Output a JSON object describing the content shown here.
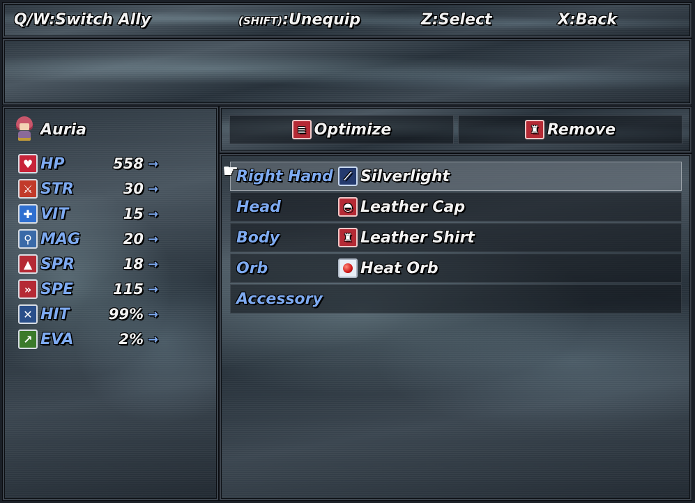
{
  "help_bar": {
    "switch_ally": "Q/W:Switch Ally",
    "unequip_key": "(SHIFT)",
    "unequip_label": ":Unequip",
    "select": "Z:Select",
    "back": "X:Back"
  },
  "description": {
    "text": ""
  },
  "actor": {
    "name": "Auria"
  },
  "stats": [
    {
      "name": "HP",
      "value": "558",
      "arrow": "→",
      "icon": "heart-icon",
      "color": "#c8243a"
    },
    {
      "name": "STR",
      "value": "30",
      "arrow": "→",
      "icon": "sword-strike-icon",
      "color": "#c23a2a"
    },
    {
      "name": "VIT",
      "value": "15",
      "arrow": "→",
      "icon": "shield-icon",
      "color": "#2f6fd0"
    },
    {
      "name": "MAG",
      "value": "20",
      "arrow": "→",
      "icon": "magic-staff-icon",
      "color": "#3a6aa8"
    },
    {
      "name": "SPR",
      "value": "18",
      "arrow": "→",
      "icon": "wizard-hat-icon",
      "color": "#b52a35"
    },
    {
      "name": "SPE",
      "value": "115",
      "arrow": "→",
      "icon": "boots-icon",
      "color": "#b52a35"
    },
    {
      "name": "HIT",
      "value": "99%",
      "arrow": "→",
      "icon": "crossed-swords-icon",
      "color": "#2a4f8a"
    },
    {
      "name": "EVA",
      "value": "2%",
      "arrow": "→",
      "icon": "winged-boot-icon",
      "color": "#3b7a2a"
    }
  ],
  "commands": {
    "optimize": "Optimize",
    "remove": "Remove"
  },
  "slots": [
    {
      "label": "Right Hand",
      "item": "Silverlight",
      "icon": "sword-icon",
      "active": true
    },
    {
      "label": "Head",
      "item": "Leather Cap",
      "icon": "cap-icon",
      "active": false
    },
    {
      "label": "Body",
      "item": "Leather Shirt",
      "icon": "shirt-icon",
      "active": false
    },
    {
      "label": "Orb",
      "item": "Heat Orb",
      "icon": "orb-icon",
      "active": false
    },
    {
      "label": "Accessory",
      "item": "",
      "icon": "",
      "active": false
    }
  ]
}
